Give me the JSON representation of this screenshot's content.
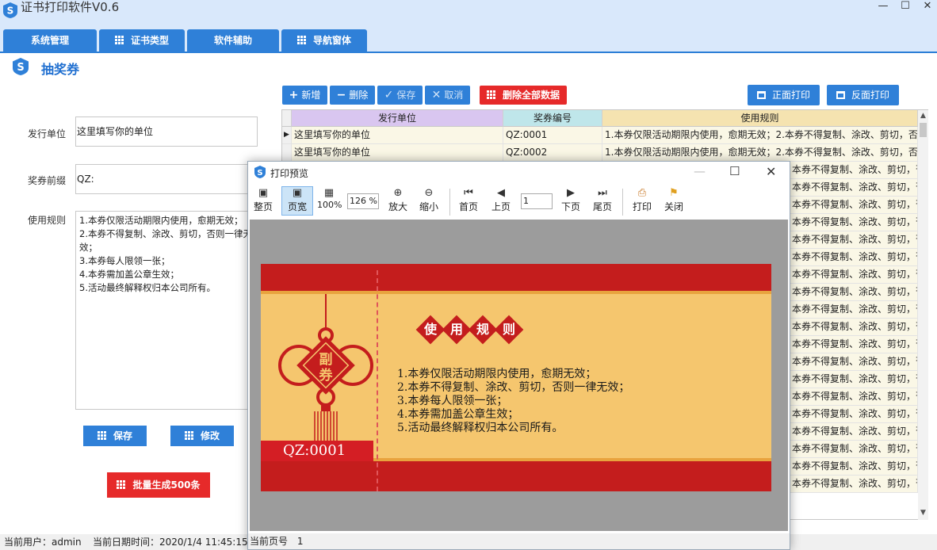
{
  "app": {
    "title": "证书打印软件V0.6",
    "window_controls": [
      "—",
      "☐",
      "✕"
    ]
  },
  "tabs": [
    {
      "label": "系统管理",
      "icon": null
    },
    {
      "label": "证书类型",
      "icon": "grid-icon"
    },
    {
      "label": "软件辅助",
      "icon": null
    },
    {
      "label": "导航窗体",
      "icon": "grid-icon"
    }
  ],
  "page": {
    "title": "抽奖券",
    "icon": "app-logo-icon"
  },
  "form": {
    "issuer_label": "发行单位",
    "issuer_value": "这里填写你的单位",
    "prefix_label": "奖券前缀",
    "prefix_value": "QZ:",
    "rules_label": "使用规则",
    "rules_value": "1.本券仅限活动期限内使用，愈期无效；\n2.本券不得复制、涂改、剪切，否则一律无效；\n3.本券每人限领一张；\n4.本券需加盖公章生效；\n5.活动最终解释权归本公司所有。",
    "save_label": "保存",
    "modify_label": "修改",
    "batch_label": "批量生成500条"
  },
  "toolbar": {
    "add": "新增",
    "delete": "删除",
    "save": "保存",
    "cancel": "取消",
    "delete_all": "删除全部数据",
    "print_front": "正面打印",
    "print_back": "反面打印"
  },
  "table": {
    "columns": [
      "发行单位",
      "奖券编号",
      "使用规则"
    ],
    "rows": [
      {
        "issuer": "这里填写你的单位",
        "code": "QZ:0001",
        "rule": "1.本券仅限活动期限内使用，愈期无效；2.本券不得复制、涂改、剪切，否"
      },
      {
        "issuer": "这里填写你的单位",
        "code": "QZ:0002",
        "rule": "1.本券仅限活动期限内使用，愈期无效；2.本券不得复制、涂改、剪切，否"
      }
    ],
    "visible_rule_tail": "本券不得复制、涂改、剪切，否"
  },
  "status": {
    "user": "当前用户：admin",
    "datetime": "当前日期时间：2020/1/4 11:45:15"
  },
  "preview": {
    "title": "打印预览",
    "tools": {
      "whole_page": "整页",
      "page_width": "页宽",
      "zoom100": "100%",
      "zoom_value": "126 %",
      "zoom_in": "放大",
      "zoom_out": "缩小",
      "first": "首页",
      "prev": "上页",
      "page_value": "1",
      "next": "下页",
      "last": "尾页",
      "print": "打印",
      "close": "关闭"
    },
    "status_label": "当前页号",
    "status_value": "1",
    "coupon": {
      "stub_text": "副券",
      "serial": "QZ:0001",
      "heading_chars": [
        "使",
        "用",
        "规",
        "则"
      ],
      "rules": [
        "1.本券仅限活动期限内使用，愈期无效；",
        "2.本券不得复制、涂改、剪切，否则一律无效；",
        "3.本券每人限领一张；",
        "4.本券需加盖公章生效；",
        "5.活动最终解释权归本公司所有。"
      ]
    }
  },
  "colors": {
    "accent_blue": "#2f80d8",
    "danger_red": "#e62a2a",
    "header_purple": "#d9c6f0",
    "header_teal": "#bfe6ea",
    "header_tan": "#f5e3b0",
    "coupon_red": "#c41d1d",
    "coupon_gold": "#f5c66e"
  }
}
